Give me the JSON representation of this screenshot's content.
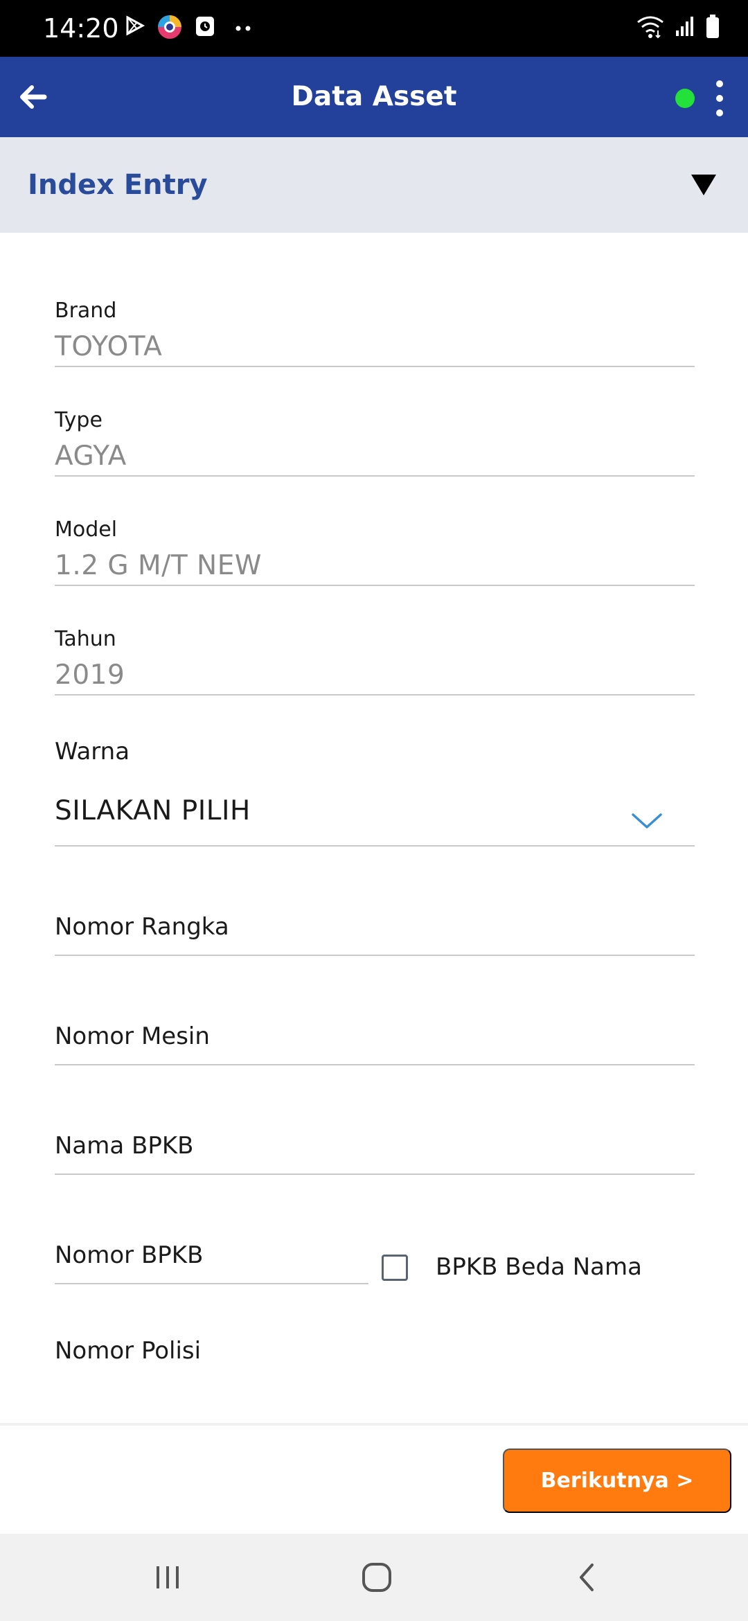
{
  "status_bar": {
    "time": "14:20"
  },
  "app_bar": {
    "title": "Data Asset",
    "online_color": "#23e03a"
  },
  "section": {
    "title": "Index Entry"
  },
  "form": {
    "brand": {
      "label": "Brand",
      "value": "TOYOTA"
    },
    "type": {
      "label": "Type",
      "value": "AGYA"
    },
    "model": {
      "label": "Model",
      "value": "1.2 G M/T NEW"
    },
    "tahun": {
      "label": "Tahun",
      "value": "2019"
    },
    "warna": {
      "label": "Warna",
      "value": "SILAKAN PILIH"
    },
    "nomor_rangka": {
      "label": "Nomor Rangka"
    },
    "nomor_mesin": {
      "label": "Nomor Mesin"
    },
    "nama_bpkb": {
      "label": "Nama BPKB"
    },
    "nomor_bpkb": {
      "label": "Nomor BPKB"
    },
    "bpkb_beda_nama": {
      "label": "BPKB Beda Nama",
      "checked": false
    },
    "nomor_polisi": {
      "label": "Nomor Polisi"
    }
  },
  "footer": {
    "next_label": "Berikutnya >"
  },
  "colors": {
    "app_bar": "#23419a",
    "accent": "#ff7b0f",
    "section_title": "#2a4a9a",
    "section_bg": "#e4e8ee"
  }
}
